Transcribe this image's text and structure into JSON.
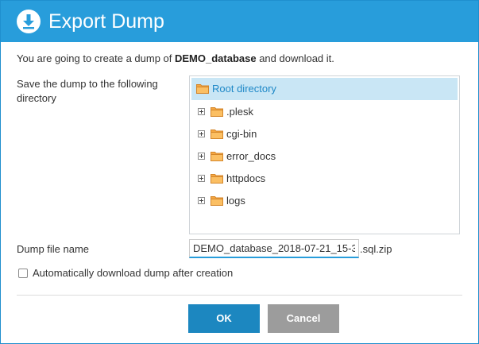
{
  "dialog": {
    "title": "Export Dump",
    "title_icon": "download-icon"
  },
  "intro": {
    "prefix": "You are going to create a dump of ",
    "db_name": "DEMO_database",
    "suffix": " and download it."
  },
  "directory": {
    "label": "Save the dump to the following directory",
    "root": "Root directory",
    "items": [
      ".plesk",
      "cgi-bin",
      "error_docs",
      "httpdocs",
      "logs"
    ]
  },
  "filename": {
    "label": "Dump file name",
    "value": "DEMO_database_2018-07-21_15-3",
    "suffix": ".sql.zip"
  },
  "auto_download": {
    "label": "Automatically download dump after creation",
    "checked": false
  },
  "buttons": {
    "ok": "OK",
    "cancel": "Cancel"
  },
  "colors": {
    "titlebar": "#289ddb",
    "primary_button": "#1c87c0",
    "secondary_button": "#9c9c9c",
    "selection": "#c9e6f5",
    "folder": "#f5a742"
  }
}
